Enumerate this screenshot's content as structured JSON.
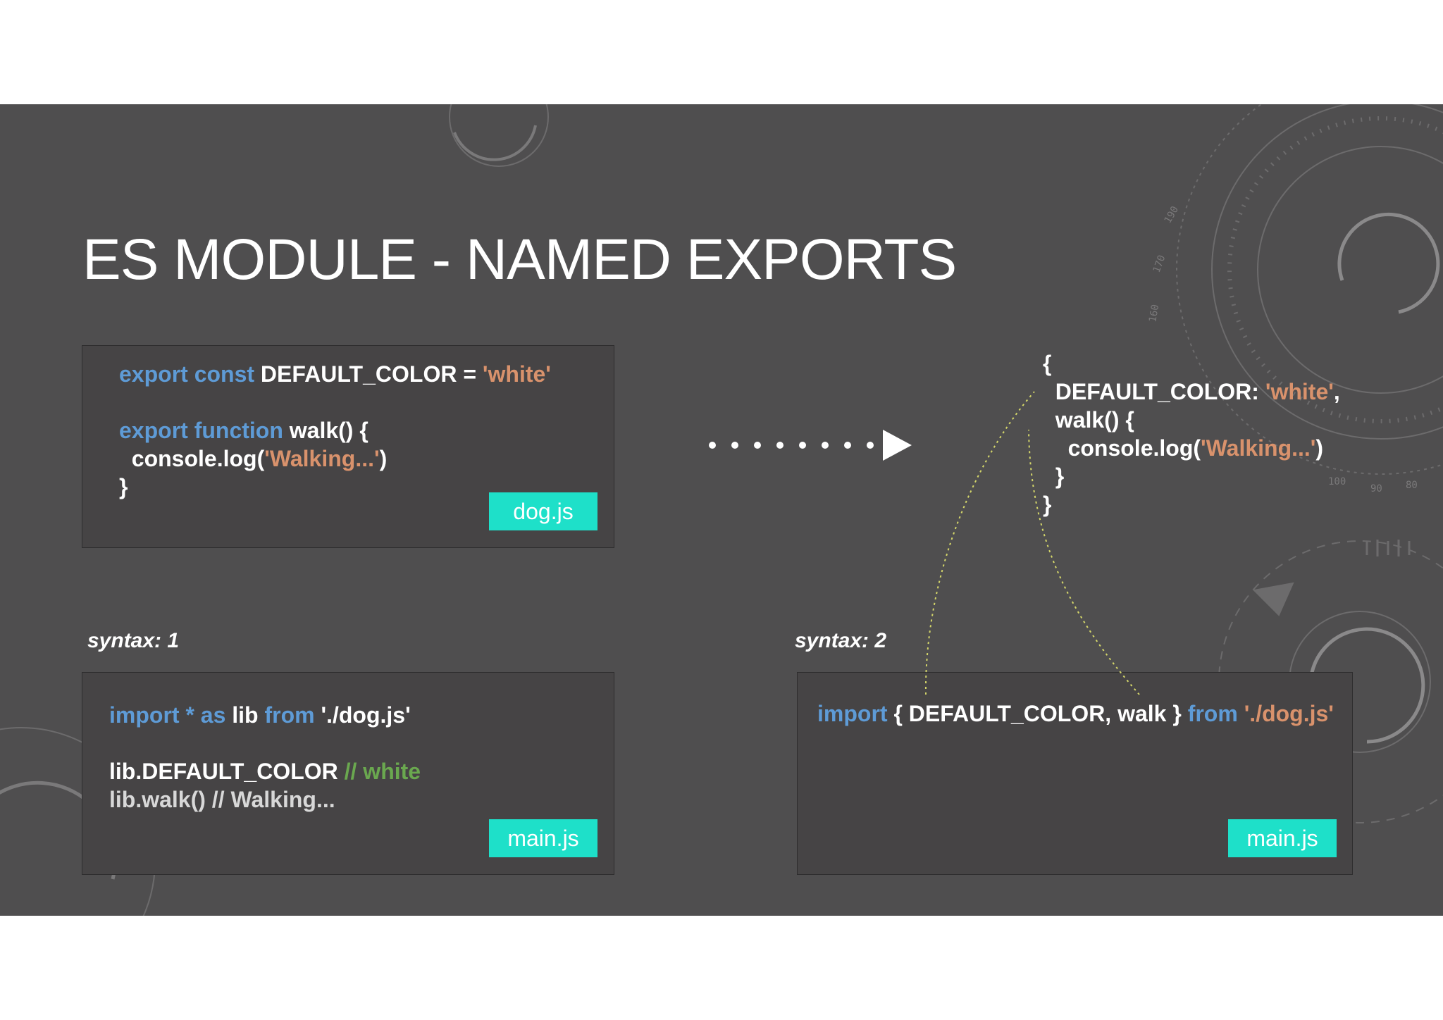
{
  "slide": {
    "title": "ES MODULE - NAMED EXPORTS",
    "accent_color": "#1ee0c9",
    "background_color": "#4f4e4f"
  },
  "code_colors": {
    "keyword": "#5e9bd6",
    "string": "#d9926c",
    "comment": "#6aa84f",
    "plain": "#ffffff"
  },
  "dog_module": {
    "filename": "dog.js",
    "line1": {
      "kw": "export const",
      "plain": " DEFAULT_COLOR = ",
      "str": "'white'"
    },
    "line2": {
      "kw": "export function",
      "plain": " walk() {"
    },
    "line3": {
      "pre": "  console.log(",
      "str": "'Walking...'",
      "post": ")"
    },
    "line4": "}"
  },
  "export_object": {
    "open": "{",
    "line1": {
      "plain": "  DEFAULT_COLOR: ",
      "str": "'white'",
      "post": ","
    },
    "line2": "  walk() {",
    "line3": {
      "pre": "    console.log(",
      "str": "'Walking...'",
      "post": ")"
    },
    "line4": "  }",
    "close": "}"
  },
  "syntax1": {
    "label": "syntax: 1",
    "filename": "main.js",
    "import_line": {
      "kw1": "import",
      "star": " *",
      "kw2": " as",
      "plain1": " lib ",
      "kw3": "from",
      "plain2": " './dog.js'"
    },
    "line2": {
      "plain": "lib.DEFAULT_COLOR ",
      "cmt": "// white"
    },
    "line3": "lib.walk() // Walking..."
  },
  "syntax2": {
    "label": "syntax: 2",
    "filename": "main.js",
    "import_line": {
      "kw1": "import",
      "plain1": " { DEFAULT_COLOR, walk } ",
      "kw2": "from",
      "str": " './dog.js'"
    }
  },
  "icons": {
    "arrow": "dotted-arrow-icon",
    "decoration": "dial-gauge-decoration"
  }
}
